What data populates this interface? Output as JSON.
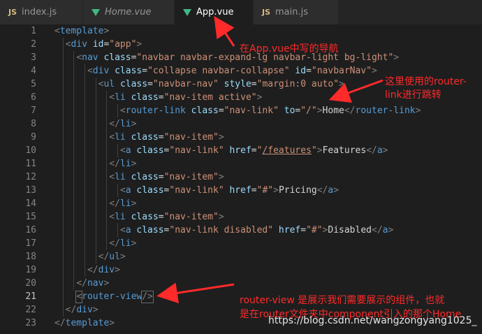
{
  "tabs": [
    {
      "kind": "js",
      "icon": "js-file-icon",
      "label": "index.js",
      "active": false,
      "italic": false
    },
    {
      "kind": "vue",
      "icon": "vue-file-icon",
      "label": "Home.vue",
      "active": false,
      "italic": true
    },
    {
      "kind": "vue",
      "icon": "vue-file-icon",
      "label": "App.vue",
      "active": true,
      "italic": false,
      "unsaved": true
    },
    {
      "kind": "js",
      "icon": "js-file-icon",
      "label": "main.js",
      "active": false,
      "italic": false
    }
  ],
  "js_badge": "JS",
  "current_line": 21,
  "lines": [
    [
      [
        "p",
        "<"
      ],
      [
        "t",
        "template"
      ],
      [
        "p",
        ">"
      ]
    ],
    [
      [
        "x",
        "  "
      ],
      [
        "p",
        "<"
      ],
      [
        "t",
        "div"
      ],
      [
        "x",
        " "
      ],
      [
        "a",
        "id"
      ],
      [
        "x",
        "="
      ],
      [
        "s",
        "\"app\""
      ],
      [
        "p",
        ">"
      ]
    ],
    [
      [
        "x",
        "    "
      ],
      [
        "p",
        "<"
      ],
      [
        "t",
        "nav"
      ],
      [
        "x",
        " "
      ],
      [
        "a",
        "class"
      ],
      [
        "x",
        "="
      ],
      [
        "s",
        "\"navbar navbar-expand-lg navbar-light bg-light\""
      ],
      [
        "p",
        ">"
      ]
    ],
    [
      [
        "x",
        "      "
      ],
      [
        "p",
        "<"
      ],
      [
        "t",
        "div"
      ],
      [
        "x",
        " "
      ],
      [
        "a",
        "class"
      ],
      [
        "x",
        "="
      ],
      [
        "s",
        "\"collapse navbar-collapse\""
      ],
      [
        "x",
        " "
      ],
      [
        "a",
        "id"
      ],
      [
        "x",
        "="
      ],
      [
        "s",
        "\"navbarNav\""
      ],
      [
        "p",
        ">"
      ]
    ],
    [
      [
        "x",
        "        "
      ],
      [
        "p",
        "<"
      ],
      [
        "t",
        "ul"
      ],
      [
        "x",
        " "
      ],
      [
        "a",
        "class"
      ],
      [
        "x",
        "="
      ],
      [
        "s",
        "\"navbar-nav\""
      ],
      [
        "x",
        " "
      ],
      [
        "a",
        "style"
      ],
      [
        "x",
        "="
      ],
      [
        "s",
        "\"margin:0 auto\""
      ],
      [
        "p",
        ">"
      ]
    ],
    [
      [
        "x",
        "          "
      ],
      [
        "p",
        "<"
      ],
      [
        "t",
        "li"
      ],
      [
        "x",
        " "
      ],
      [
        "a",
        "class"
      ],
      [
        "x",
        "="
      ],
      [
        "s",
        "\"nav-item active\""
      ],
      [
        "p",
        ">"
      ]
    ],
    [
      [
        "x",
        "            "
      ],
      [
        "p",
        "<"
      ],
      [
        "t",
        "router-link"
      ],
      [
        "x",
        " "
      ],
      [
        "a",
        "class"
      ],
      [
        "x",
        "="
      ],
      [
        "s",
        "\"nav-link\""
      ],
      [
        "x",
        " "
      ],
      [
        "a",
        "to"
      ],
      [
        "x",
        "="
      ],
      [
        "s",
        "\"/\""
      ],
      [
        "p",
        ">"
      ],
      [
        "x",
        "Home"
      ],
      [
        "p",
        "</"
      ],
      [
        "t",
        "router-link"
      ],
      [
        "p",
        ">"
      ]
    ],
    [
      [
        "x",
        "          "
      ],
      [
        "p",
        "</"
      ],
      [
        "t",
        "li"
      ],
      [
        "p",
        ">"
      ]
    ],
    [
      [
        "x",
        "          "
      ],
      [
        "p",
        "<"
      ],
      [
        "t",
        "li"
      ],
      [
        "x",
        " "
      ],
      [
        "a",
        "class"
      ],
      [
        "x",
        "="
      ],
      [
        "s",
        "\"nav-item\""
      ],
      [
        "p",
        ">"
      ]
    ],
    [
      [
        "x",
        "            "
      ],
      [
        "p",
        "<"
      ],
      [
        "t",
        "a"
      ],
      [
        "x",
        " "
      ],
      [
        "a",
        "class"
      ],
      [
        "x",
        "="
      ],
      [
        "s",
        "\"nav-link\""
      ],
      [
        "x",
        " "
      ],
      [
        "a",
        "href"
      ],
      [
        "x",
        "="
      ],
      [
        "s",
        "\""
      ],
      [
        "su",
        "/features"
      ],
      [
        "s",
        "\""
      ],
      [
        "p",
        ">"
      ],
      [
        "x",
        "Features"
      ],
      [
        "p",
        "</"
      ],
      [
        "t",
        "a"
      ],
      [
        "p",
        ">"
      ]
    ],
    [
      [
        "x",
        "          "
      ],
      [
        "p",
        "</"
      ],
      [
        "t",
        "li"
      ],
      [
        "p",
        ">"
      ]
    ],
    [
      [
        "x",
        "          "
      ],
      [
        "p",
        "<"
      ],
      [
        "t",
        "li"
      ],
      [
        "x",
        " "
      ],
      [
        "a",
        "class"
      ],
      [
        "x",
        "="
      ],
      [
        "s",
        "\"nav-item\""
      ],
      [
        "p",
        ">"
      ]
    ],
    [
      [
        "x",
        "            "
      ],
      [
        "p",
        "<"
      ],
      [
        "t",
        "a"
      ],
      [
        "x",
        " "
      ],
      [
        "a",
        "class"
      ],
      [
        "x",
        "="
      ],
      [
        "s",
        "\"nav-link\""
      ],
      [
        "x",
        " "
      ],
      [
        "a",
        "href"
      ],
      [
        "x",
        "="
      ],
      [
        "s",
        "\"#\""
      ],
      [
        "p",
        ">"
      ],
      [
        "x",
        "Pricing"
      ],
      [
        "p",
        "</"
      ],
      [
        "t",
        "a"
      ],
      [
        "p",
        ">"
      ]
    ],
    [
      [
        "x",
        "          "
      ],
      [
        "p",
        "</"
      ],
      [
        "t",
        "li"
      ],
      [
        "p",
        ">"
      ]
    ],
    [
      [
        "x",
        "          "
      ],
      [
        "p",
        "<"
      ],
      [
        "t",
        "li"
      ],
      [
        "x",
        " "
      ],
      [
        "a",
        "class"
      ],
      [
        "x",
        "="
      ],
      [
        "s",
        "\"nav-item\""
      ],
      [
        "p",
        ">"
      ]
    ],
    [
      [
        "x",
        "            "
      ],
      [
        "p",
        "<"
      ],
      [
        "t",
        "a"
      ],
      [
        "x",
        " "
      ],
      [
        "a",
        "class"
      ],
      [
        "x",
        "="
      ],
      [
        "s",
        "\"nav-link disabled\""
      ],
      [
        "x",
        " "
      ],
      [
        "a",
        "href"
      ],
      [
        "x",
        "="
      ],
      [
        "s",
        "\"#\""
      ],
      [
        "p",
        ">"
      ],
      [
        "x",
        "Disabled"
      ],
      [
        "p",
        "</"
      ],
      [
        "t",
        "a"
      ],
      [
        "p",
        ">"
      ]
    ],
    [
      [
        "x",
        "          "
      ],
      [
        "p",
        "</"
      ],
      [
        "t",
        "li"
      ],
      [
        "p",
        ">"
      ]
    ],
    [
      [
        "x",
        "        "
      ],
      [
        "p",
        "</"
      ],
      [
        "t",
        "ul"
      ],
      [
        "p",
        ">"
      ]
    ],
    [
      [
        "x",
        "      "
      ],
      [
        "p",
        "</"
      ],
      [
        "t",
        "div"
      ],
      [
        "p",
        ">"
      ]
    ],
    [
      [
        "x",
        "    "
      ],
      [
        "p",
        "</"
      ],
      [
        "t",
        "nav"
      ],
      [
        "p",
        ">"
      ]
    ],
    [
      [
        "x",
        "    "
      ],
      [
        "p",
        "<"
      ],
      [
        "t",
        "router-view"
      ],
      [
        "p",
        "/>"
      ]
    ],
    [
      [
        "x",
        "  "
      ],
      [
        "p",
        "</"
      ],
      [
        "t",
        "div"
      ],
      [
        "p",
        ">"
      ]
    ],
    [
      [
        "p",
        "</"
      ],
      [
        "t",
        "template"
      ],
      [
        "p",
        ">"
      ]
    ]
  ],
  "annotations": {
    "nav_note": "在App.vue中写的导航",
    "router_link_note_1": "这里使用的router-",
    "router_link_note_2": "link进行跳转",
    "router_view_note_1": "router-view 是展示我们需要展示的组件，也就",
    "router_view_note_2": "是在router文件夹中component引入的那个Home"
  },
  "watermark": "https://blog.csdn.net/wangzongyang1025_",
  "colors": {
    "tag": "#569cd6",
    "attr": "#9cdcfe",
    "string": "#ce9178",
    "punct": "#808080",
    "text": "#d4d4d4",
    "annotation": "#ff2a2a",
    "background": "#1e1e1e"
  }
}
